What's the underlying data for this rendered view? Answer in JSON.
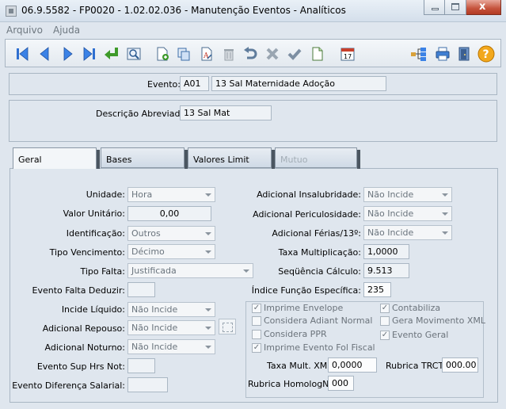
{
  "window": {
    "title": "06.9.5582 - FP0020 - 1.02.02.036 - Manutenção Eventos - Analíticos",
    "min_glyph": "",
    "max_glyph": "",
    "close_glyph": "x"
  },
  "menu": {
    "items": [
      "Arquivo",
      "Ajuda"
    ]
  },
  "toolbar": {
    "icons": [
      "first-record-icon",
      "previous-record-icon",
      "next-record-icon",
      "last-record-icon",
      "enter-icon",
      "preview-icon",
      "new-record-icon",
      "copy-record-icon",
      "spell-check-icon",
      "delete-icon",
      "undo-icon",
      "cancel-icon",
      "confirm-icon",
      "new-document-icon",
      "calendar-icon",
      "tree-icon",
      "print-icon",
      "exit-icon",
      "help-icon"
    ],
    "calendar_text": "17",
    "help_text": "?"
  },
  "header": {
    "evento_label": "Evento:",
    "evento_code": "A01",
    "evento_desc": "13 Sal Maternidade Adoção",
    "descricao_label": "Descrição Abreviada:",
    "descricao_value": "13 Sal Mat"
  },
  "tabs": [
    {
      "label": "Geral"
    },
    {
      "label": "Bases"
    },
    {
      "label": "Valores Limit"
    },
    {
      "label": "Mutuo"
    }
  ],
  "geral": {
    "unidade_label": "Unidade:",
    "unidade_value": "Hora",
    "valor_unitario_label": "Valor Unitário:",
    "valor_unitario_value": "0,00",
    "identificacao_label": "Identificação:",
    "identificacao_value": "Outros",
    "tipo_vencimento_label": "Tipo Vencimento:",
    "tipo_vencimento_value": "Décimo",
    "tipo_falta_label": "Tipo Falta:",
    "tipo_falta_value": "Justificada",
    "evento_falta_label": "Evento Falta Deduzir:",
    "evento_falta_value": "",
    "incide_liquido_label": "Incide Líquido:",
    "incide_liquido_value": "Não Incide",
    "adicional_repouso_label": "Adicional Repouso:",
    "adicional_repouso_value": "Não Incide",
    "adicional_noturno_label": "Adicional Noturno:",
    "adicional_noturno_value": "Não Incide",
    "evento_sup_label": "Evento Sup Hrs Not:",
    "evento_sup_value": "",
    "evento_dif_label": "Evento Diferença Salarial:",
    "evento_dif_value": "",
    "insalubridade_label": "Adicional Insalubridade:",
    "insalubridade_value": "Não Incide",
    "periculosidade_label": "Adicional Periculosidade:",
    "periculosidade_value": "Não Incide",
    "ferias_label": "Adicional Férias/13º:",
    "ferias_value": "Não Incide",
    "taxa_mult_label": "Taxa Multiplicação:",
    "taxa_mult_value": "1,0000",
    "sequencia_label": "Seqüência Cálculo:",
    "sequencia_value": "9.513",
    "indice_label": "Índice Função Específica:",
    "indice_value": "235",
    "checkboxes": [
      {
        "label": "Imprime Envelope",
        "checked": true
      },
      {
        "label": "Considera Adiant Normal",
        "checked": false
      },
      {
        "label": "Considera PPR",
        "checked": false
      },
      {
        "label": "Imprime Evento Fol Fiscal",
        "checked": true
      },
      {
        "label": "Contabiliza",
        "checked": true
      },
      {
        "label": "Gera Movimento XML",
        "checked": false
      },
      {
        "label": "Evento Geral",
        "checked": true
      }
    ],
    "check_mark": "✓",
    "taxa_xml_label": "Taxa Mult. XML:",
    "taxa_xml_value": "0,0000",
    "rubrica_trct_label": "Rubrica TRCT:",
    "rubrica_trct_value": "000.00",
    "rubrica_homolog_label": "Rubrica HomologNet:",
    "rubrica_homolog_value": "000"
  }
}
